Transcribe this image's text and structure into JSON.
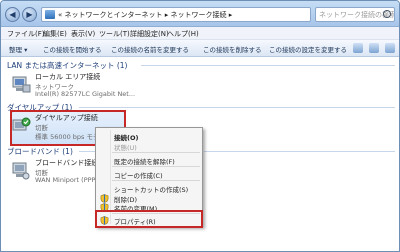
{
  "window": {
    "title_controls": {
      "minimize": "–",
      "maximize": "□",
      "close": "✕"
    },
    "back": "◀",
    "forward": "▶",
    "address": "«  ネットワークとインターネット ▸ ネットワーク接続 ▸",
    "search_placeholder": "ネットワーク接続の検索"
  },
  "menu": [
    "ファイル(F)",
    "編集(E)",
    "表示(V)",
    "ツール(T)",
    "詳細設定(N)",
    "ヘルプ(H)"
  ],
  "toolbar": [
    "整理 ▾",
    "この接続を開始する",
    "この接続の名前を変更する",
    "この接続を削除する",
    "この接続の設定を変更する"
  ],
  "groups": {
    "lan": "LAN または高速インターネット (1)",
    "dialup": "ダイヤルアップ (1)",
    "broadband": "ブロードバンド (1)"
  },
  "items": {
    "lan": {
      "name": "ローカル エリア接続",
      "line2": "ネットワーク",
      "line3": "Intel(R) 82577LC Gigabit Net..."
    },
    "dialup": {
      "name": "ダイヤルアップ接続",
      "line2": "切断",
      "line3": "標準 56000 bps モデム"
    },
    "broadband": {
      "name": "ブロードバンド接続",
      "line2": "切断",
      "line3": "WAN Miniport (PPPOE)"
    }
  },
  "context_menu": {
    "connect": "接続(O)",
    "status": "状態(U)",
    "set_default": "既定の接続を解除(F)",
    "copy": "コピーの作成(C)",
    "shortcut": "ショートカットの作成(S)",
    "delete": "削除(D)",
    "rename": "名前の変更(M)",
    "properties": "プロパティ(R)"
  },
  "colors": {
    "accent": "#1e3e79",
    "highlight": "#c62828"
  }
}
